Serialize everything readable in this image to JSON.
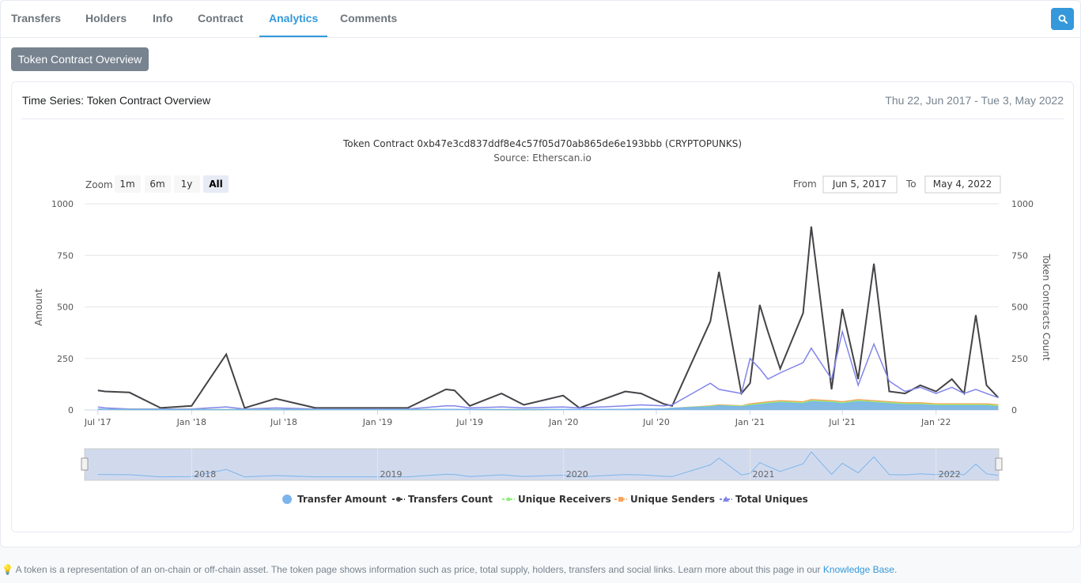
{
  "tabs": [
    {
      "label": "Transfers",
      "active": false
    },
    {
      "label": "Holders",
      "active": false
    },
    {
      "label": "Info",
      "active": false
    },
    {
      "label": "Contract",
      "active": false
    },
    {
      "label": "Analytics",
      "active": true
    },
    {
      "label": "Comments",
      "active": false
    }
  ],
  "overview_button": "Token Contract Overview",
  "panel": {
    "title": "Time Series: Token Contract Overview",
    "range": "Thu 22, Jun 2017 - Tue 3, May 2022"
  },
  "chart": {
    "title": "Token Contract 0xb47e3cd837ddf8e4c57f05d70ab865de6e193bbb (CRYPTOPUNKS)",
    "subtitle": "Source: Etherscan.io",
    "zoom_label": "Zoom",
    "zoom_buttons": [
      "1m",
      "6m",
      "1y",
      "All"
    ],
    "zoom_selected": "All",
    "from_label": "From",
    "from_value": "Jun 5, 2017",
    "to_label": "To",
    "to_value": "May 4, 2022",
    "navigator_years": [
      "2018",
      "2019",
      "2020",
      "2021",
      "2022"
    ]
  },
  "chart_data": {
    "type": "line",
    "title": "Token Contract 0xb47e3cd837ddf8e4c57f05d70ab865de6e193bbb (CRYPTOPUNKS)",
    "subtitle": "Source: Etherscan.io",
    "ylabel": "Amount",
    "y2label": "Token Contracts Count",
    "ylim": [
      0,
      1000
    ],
    "yticks": [
      0,
      250,
      500,
      750,
      1000
    ],
    "xticks": [
      "Jul '17",
      "Jan '18",
      "Jul '18",
      "Jan '19",
      "Jul '19",
      "Jan '20",
      "Jul '20",
      "Jan '21",
      "Jul '21",
      "Jan '22"
    ],
    "legend_position": "bottom",
    "grid": true,
    "x": [
      "2017-07-01",
      "2017-07-15",
      "2017-09-01",
      "2017-11-01",
      "2018-01-01",
      "2018-03-10",
      "2018-04-15",
      "2018-06-15",
      "2018-09-01",
      "2018-11-01",
      "2019-01-01",
      "2019-03-01",
      "2019-05-15",
      "2019-06-01",
      "2019-07-01",
      "2019-09-01",
      "2019-10-15",
      "2019-12-31",
      "2020-02-01",
      "2020-05-01",
      "2020-06-01",
      "2020-07-15",
      "2020-08-01",
      "2020-10-15",
      "2020-11-01",
      "2020-12-15",
      "2021-01-01",
      "2021-01-20",
      "2021-02-05",
      "2021-03-01",
      "2021-04-15",
      "2021-05-01",
      "2021-06-10",
      "2021-07-01",
      "2021-08-01",
      "2021-09-01",
      "2021-10-01",
      "2021-11-01",
      "2021-12-01",
      "2022-01-01",
      "2022-02-01",
      "2022-02-25",
      "2022-03-20",
      "2022-04-10",
      "2022-05-03"
    ],
    "series": [
      {
        "name": "Transfer Amount",
        "color": "#7cb5ec",
        "values": [
          5,
          3,
          2,
          2,
          2,
          2,
          2,
          2,
          2,
          2,
          2,
          2,
          3,
          3,
          3,
          2,
          2,
          3,
          3,
          3,
          5,
          5,
          8,
          15,
          20,
          15,
          20,
          25,
          30,
          35,
          30,
          40,
          35,
          30,
          40,
          35,
          30,
          25,
          25,
          20,
          20,
          20,
          20,
          20,
          15
        ]
      },
      {
        "name": "Transfers Count",
        "color": "#434348",
        "values": [
          95,
          90,
          85,
          10,
          20,
          270,
          10,
          55,
          10,
          10,
          10,
          10,
          100,
          95,
          20,
          80,
          25,
          70,
          10,
          90,
          80,
          30,
          20,
          430,
          670,
          80,
          130,
          510,
          380,
          200,
          470,
          890,
          100,
          490,
          150,
          710,
          90,
          80,
          120,
          90,
          150,
          80,
          460,
          120,
          60
        ]
      },
      {
        "name": "Unique Receivers",
        "color": "#90ed7d",
        "values": [
          4,
          3,
          2,
          2,
          2,
          2,
          2,
          2,
          2,
          2,
          2,
          2,
          3,
          3,
          3,
          2,
          2,
          3,
          3,
          3,
          5,
          5,
          8,
          18,
          22,
          18,
          25,
          30,
          35,
          40,
          35,
          45,
          40,
          35,
          45,
          40,
          35,
          30,
          30,
          25,
          25,
          25,
          25,
          25,
          20
        ]
      },
      {
        "name": "Unique Senders",
        "color": "#f7a35c",
        "values": [
          4,
          3,
          2,
          2,
          2,
          2,
          2,
          2,
          2,
          2,
          2,
          2,
          3,
          3,
          3,
          2,
          2,
          3,
          3,
          3,
          5,
          5,
          8,
          20,
          25,
          20,
          30,
          35,
          40,
          45,
          40,
          50,
          45,
          40,
          50,
          45,
          40,
          35,
          35,
          30,
          30,
          30,
          30,
          30,
          25
        ]
      },
      {
        "name": "Total Uniques",
        "color": "#8085e9",
        "values": [
          15,
          10,
          5,
          5,
          5,
          15,
          5,
          10,
          5,
          5,
          5,
          5,
          20,
          20,
          10,
          15,
          10,
          15,
          10,
          20,
          25,
          20,
          25,
          130,
          100,
          80,
          250,
          200,
          150,
          180,
          230,
          300,
          150,
          380,
          120,
          320,
          140,
          90,
          110,
          80,
          110,
          80,
          100,
          80,
          60
        ]
      }
    ]
  }
}
